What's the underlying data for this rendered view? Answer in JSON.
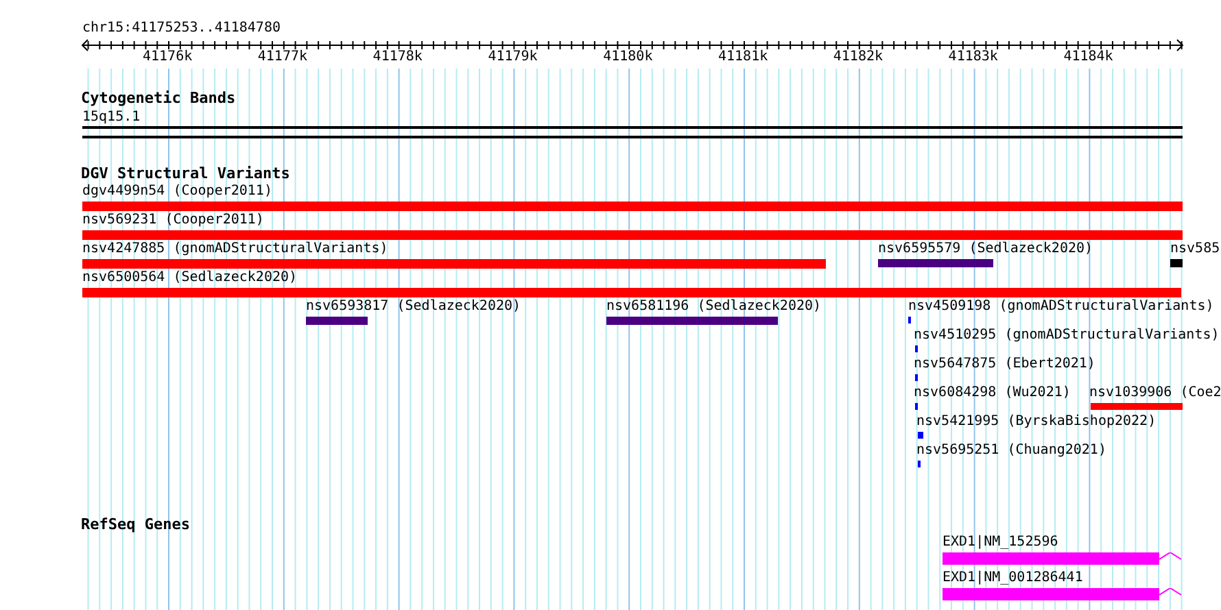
{
  "ruler": {
    "location": "chr15:41175253..41184780",
    "ticks": [
      "41176k",
      "41177k",
      "41178k",
      "41179k",
      "41180k",
      "41181k",
      "41182k",
      "41183k",
      "41184k"
    ]
  },
  "tracks": [
    {
      "title": "Cytogenetic Bands",
      "kind": "bands",
      "features": [
        {
          "label": "15q15.1"
        }
      ]
    },
    {
      "title": "DGV Structural Variants",
      "kind": "variants",
      "features": [
        {
          "label": "dgv4499n54 (Cooper2011)",
          "color": "#ff0000"
        },
        {
          "label": "nsv569231 (Cooper2011)",
          "color": "#ff0000"
        },
        {
          "label": "nsv4247885 (gnomADStructuralVariants)",
          "color": "#ff0000"
        },
        {
          "label": "nsv6595579 (Sedlazeck2020)",
          "color": "#4b0082"
        },
        {
          "label": "nsv585",
          "color": "#000000"
        },
        {
          "label": "nsv6500564 (Sedlazeck2020)",
          "color": "#ff0000"
        },
        {
          "label": "nsv6593817 (Sedlazeck2020)",
          "color": "#4b0082"
        },
        {
          "label": "nsv6581196 (Sedlazeck2020)",
          "color": "#4b0082"
        },
        {
          "label": "nsv4509198 (gnomADStructuralVariants)",
          "color": "#0000ff"
        },
        {
          "label": "nsv4510295 (gnomADStructuralVariants)",
          "color": "#0000ff"
        },
        {
          "label": "nsv5647875 (Ebert2021)",
          "color": "#0000ff"
        },
        {
          "label": "nsv6084298 (Wu2021)",
          "color": "#0000ff"
        },
        {
          "label": "nsv1039906 (Coe2",
          "color": "#ff0000"
        },
        {
          "label": "nsv5421995 (ByrskaBishop2022)",
          "color": "#0000ff"
        },
        {
          "label": "nsv5695251 (Chuang2021)",
          "color": "#0000ff"
        }
      ]
    },
    {
      "title": "RefSeq Genes",
      "kind": "genes",
      "features": [
        {
          "label": "EXD1|NM_152596",
          "color": "#ff00ff"
        },
        {
          "label": "EXD1|NM_001286441",
          "color": "#ff00ff"
        }
      ]
    }
  ]
}
